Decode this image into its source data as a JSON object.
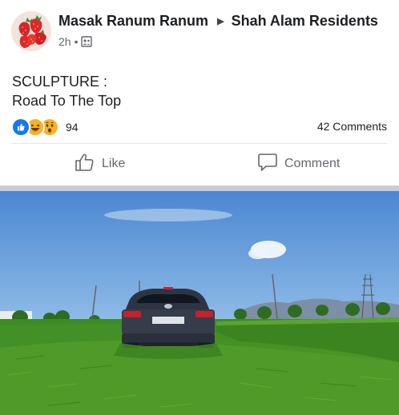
{
  "post": {
    "author": "Masak Ranum Ranum",
    "group": "Shah Alam Residents",
    "time": "2h",
    "separator": "•",
    "audience_icon": "group-audience-icon",
    "caption_line1": "SCULPTURE :",
    "caption_line2": "Road To The Top"
  },
  "reactions": {
    "types": [
      "like",
      "haha",
      "wow"
    ],
    "count": "94",
    "comments": "42 Comments"
  },
  "actions": {
    "like_label": "Like",
    "comment_label": "Comment"
  },
  "colors": {
    "like_blue": "#1877f2",
    "emoji_yellow": "#f7b125",
    "muted_text": "#65676b",
    "divider": "#e4e6eb"
  }
}
